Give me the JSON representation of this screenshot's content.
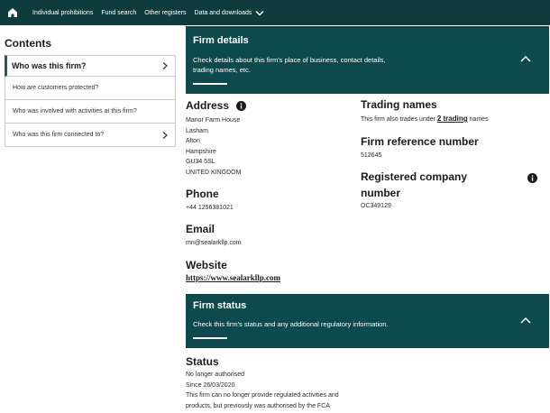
{
  "nav": {
    "items": [
      "Individual prohibitions",
      "Fund search",
      "Other registers",
      "Data and downloads"
    ]
  },
  "sidebar": {
    "title": "Contents",
    "items": [
      {
        "label": "Who was this firm?"
      },
      {
        "label": "How are customers protected?"
      },
      {
        "label": "Who was involved with activities at this firm?"
      },
      {
        "label": "Who was this firm connected to?"
      }
    ]
  },
  "firm_details": {
    "title": "Firm details",
    "description_line1": "Check details about this firm's place of business, contact details,",
    "description_line2": "trading names, etc."
  },
  "address": {
    "heading": "Address",
    "lines": [
      "Manor Farm House",
      "Lasham",
      "Alton",
      "Hampshire",
      "GU34 5SL",
      "UNITED KINGDOM"
    ]
  },
  "phone": {
    "heading": "Phone",
    "value": "+44 1256381021"
  },
  "email": {
    "heading": "Email",
    "value": "mn@sealarkllp.com"
  },
  "website": {
    "heading": "Website",
    "value": "https://www.sealarkllp.com"
  },
  "trading": {
    "heading": "Trading names",
    "text_before": "This firm also trades under",
    "link": "2 trading",
    "text_after": "names"
  },
  "frn": {
    "heading": "Firm reference number",
    "value": "512645"
  },
  "company": {
    "heading_line1": "Registered company",
    "heading_line2": "number",
    "value": "OC349129"
  },
  "firm_status": {
    "title": "Firm status",
    "description": "Check this firm's status and any additional regulatory information."
  },
  "status": {
    "heading": "Status",
    "value": "No longer authorised",
    "since": "Since 26/03/2020",
    "note_line1": "This firm can no longer provide regulated activities and",
    "note_line2": "products, but previously was authorised by the FCA"
  },
  "colors": {
    "header_bg": "#0d3b3e",
    "panel_bg": "#0d4a4d",
    "accent": "#1f5d5f"
  }
}
